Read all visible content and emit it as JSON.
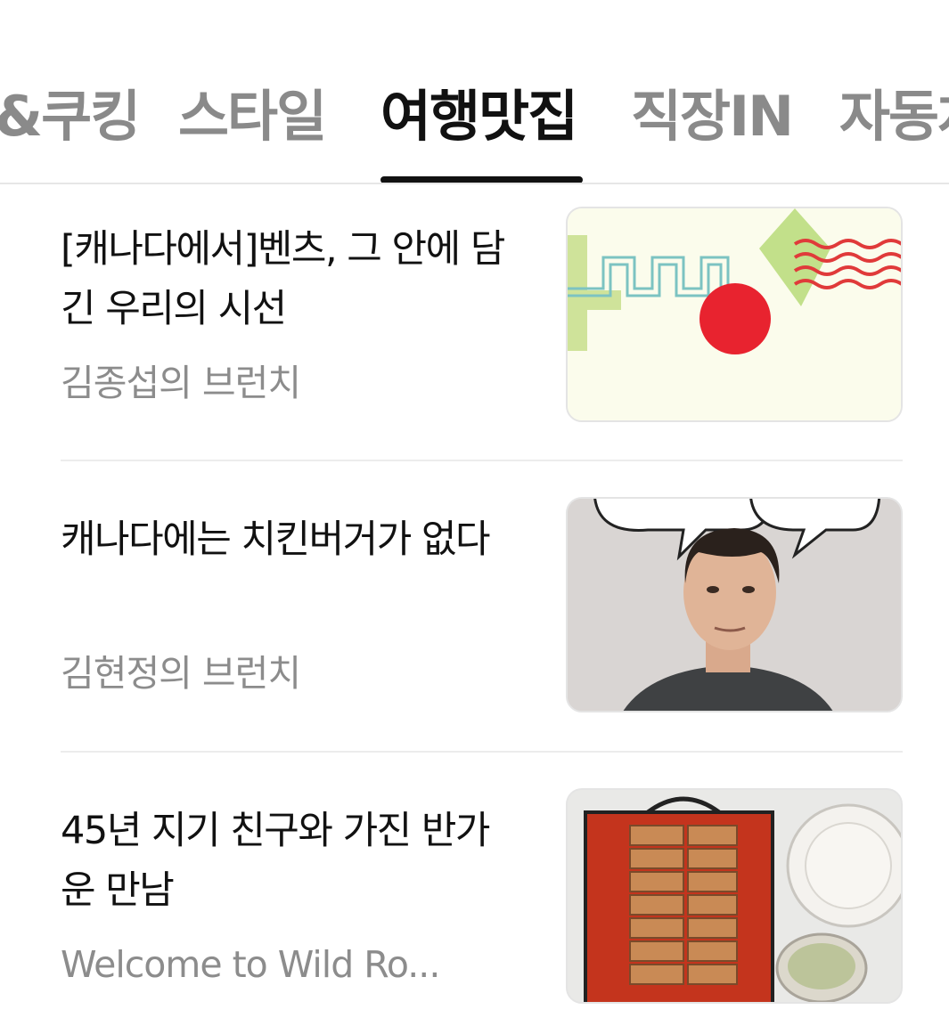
{
  "tabs": [
    {
      "label": "&쿠킹",
      "active": false
    },
    {
      "label": "스타일",
      "active": false
    },
    {
      "label": "여행맛집",
      "active": true
    },
    {
      "label": "직장IN",
      "active": false
    },
    {
      "label": "자동차",
      "active": false
    }
  ],
  "articles": [
    {
      "title": "[캐나다에서]벤츠, 그 안에 담긴 우리의 시선",
      "source": "김종섭의 브런치",
      "thumbnail": "abstract-pattern-image"
    },
    {
      "title": "캐나다에는 치킨버거가 없다",
      "source": "김현정의 브런치",
      "thumbnail": "man-thinking-image"
    },
    {
      "title": "45년 지기 친구와 가진 반가운 만남",
      "source": "Welcome to Wild Ro...",
      "thumbnail": "food-platter-image"
    }
  ],
  "colors": {
    "active_tab": "#111111",
    "inactive_tab": "#8a8a8a",
    "source_text": "#8c8c8c"
  }
}
